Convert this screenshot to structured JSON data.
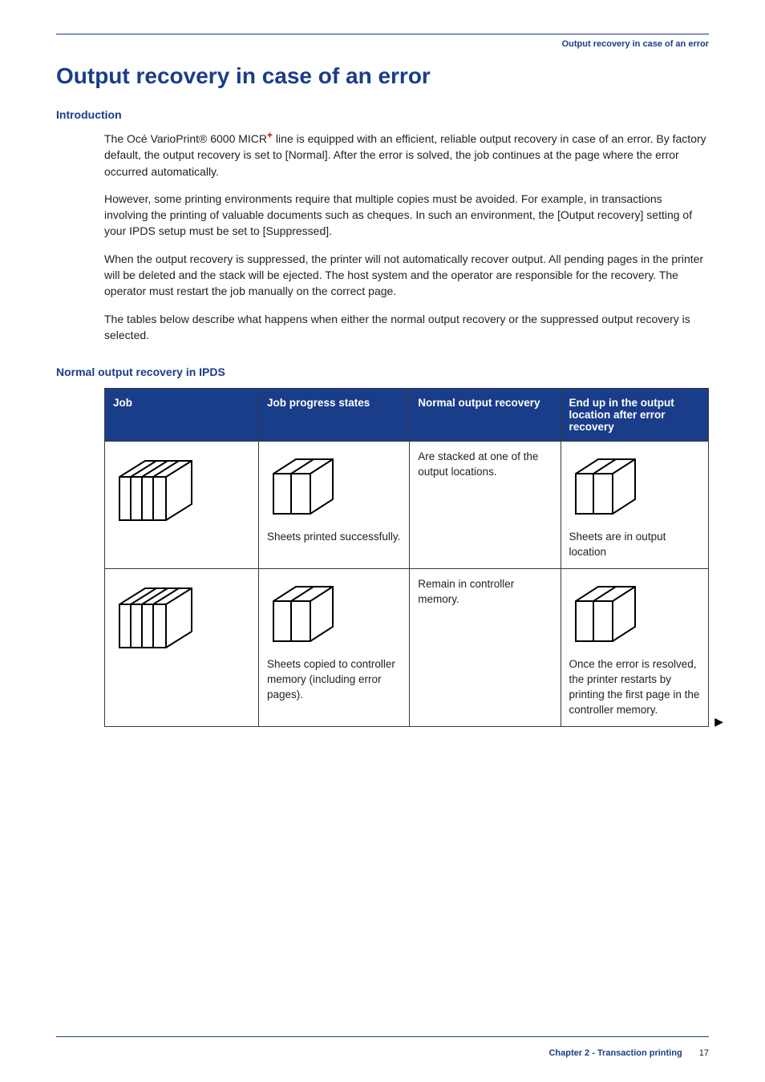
{
  "header": {
    "running_title": "Output recovery in case of an error"
  },
  "title": "Output recovery in case of an error",
  "intro_heading": "Introduction",
  "intro_paragraphs": {
    "p1_a": "The Océ VarioPrint® 6000 MICR",
    "p1_plus": "+",
    "p1_b": " line is equipped with an efficient, reliable output recovery in case of an error. By factory default, the output recovery is set to [Normal]. After the error is solved, the job continues at the page where the error occurred automatically.",
    "p2": "However, some printing environments require that multiple copies must be avoided. For example, in transactions involving the printing of valuable documents such as cheques. In such an environment, the [Output recovery] setting of your IPDS setup must be set to [Suppressed].",
    "p3": "When the output recovery is suppressed, the printer will not automatically recover output. All pending pages in the printer will be deleted and the stack will be ejected. The host system and the operator are responsible for the recovery. The operator must restart the job manually on the correct page.",
    "p4": "The tables below describe what happens when either the normal output recovery or the suppressed output recovery is selected."
  },
  "table_heading": "Normal output recovery in IPDS",
  "table": {
    "headers": {
      "c1": "Job",
      "c2": "Job progress states",
      "c3": "Normal output recovery",
      "c4": "End up in the output location after error recovery"
    },
    "rows": [
      {
        "c2_caption": "Sheets printed successfully.",
        "c3": "Are stacked at one of the output locations.",
        "c4_caption": "Sheets are in output location"
      },
      {
        "c2_caption": "Sheets copied to controller memory (including error pages).",
        "c3": "Remain in controller memory.",
        "c4_caption": "Once the error is resolved, the printer restarts by printing the first page in the controller memory."
      }
    ]
  },
  "continue_glyph": "▶",
  "footer": {
    "chapter": "Chapter 2 - Transaction printing",
    "page": "17"
  }
}
